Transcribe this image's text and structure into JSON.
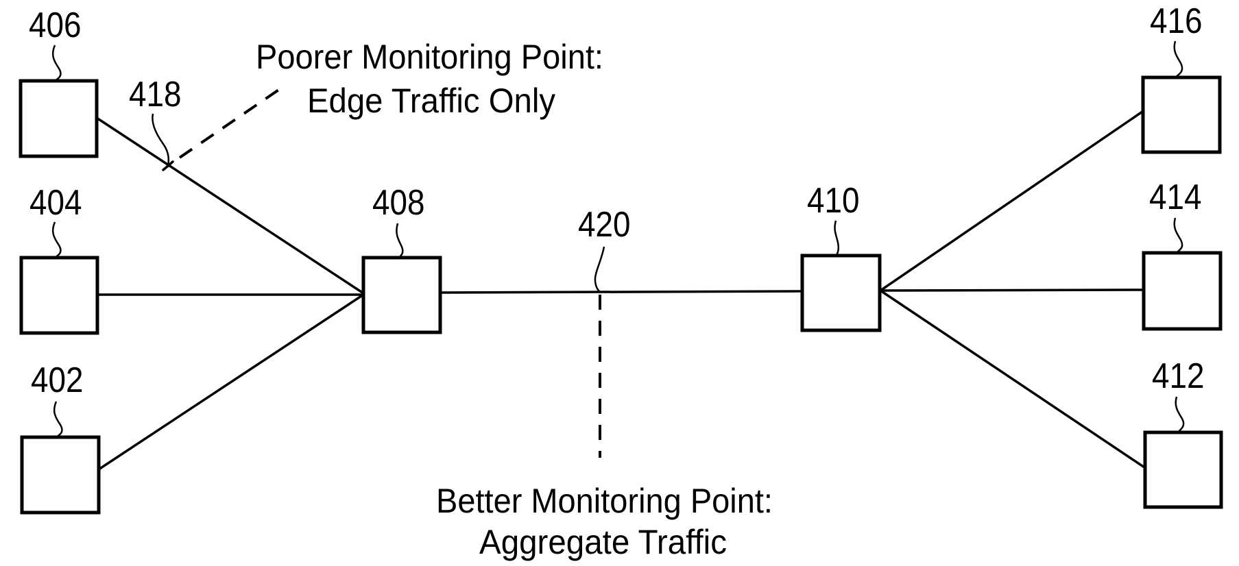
{
  "figure": {
    "nodes": [
      {
        "id": "402",
        "label": "402"
      },
      {
        "id": "404",
        "label": "404"
      },
      {
        "id": "406",
        "label": "406"
      },
      {
        "id": "408",
        "label": "408"
      },
      {
        "id": "410",
        "label": "410"
      },
      {
        "id": "412",
        "label": "412"
      },
      {
        "id": "414",
        "label": "414"
      },
      {
        "id": "416",
        "label": "416"
      }
    ],
    "links": [
      {
        "from": "406",
        "to": "408"
      },
      {
        "from": "404",
        "to": "408"
      },
      {
        "from": "402",
        "to": "408"
      },
      {
        "from": "408",
        "to": "410"
      },
      {
        "from": "410",
        "to": "416"
      },
      {
        "from": "410",
        "to": "414"
      },
      {
        "from": "410",
        "to": "412"
      }
    ],
    "monitoring_points": [
      {
        "id": "418",
        "label": "418",
        "on_link": "406-408",
        "note_lines": [
          "Poorer Monitoring Point:",
          "Edge Traffic Only"
        ]
      },
      {
        "id": "420",
        "label": "420",
        "on_link": "408-410",
        "note_lines": [
          "Better Monitoring Point:",
          "Aggregate Traffic"
        ]
      }
    ]
  }
}
